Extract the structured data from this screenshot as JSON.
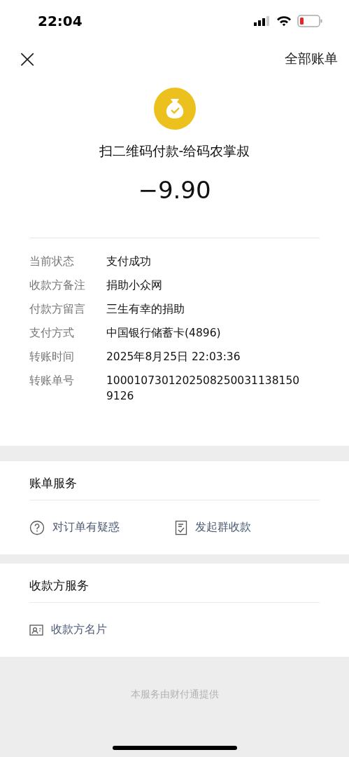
{
  "status_bar": {
    "time": "22:04"
  },
  "nav": {
    "close": "×",
    "right_link": "全部账单"
  },
  "payment": {
    "title": "扫二维码付款-给码农掌叔",
    "amount": "−9.90"
  },
  "details": [
    {
      "label": "当前状态",
      "value": "支付成功"
    },
    {
      "label": "收款方备注",
      "value": "捐助小众网"
    },
    {
      "label": "付款方留言",
      "value": "三生有幸的捐助"
    },
    {
      "label": "支付方式",
      "value": "中国银行储蓄卡(4896)"
    },
    {
      "label": "转账时间",
      "value": "2025年8月25日 22:03:36"
    },
    {
      "label": "转账单号",
      "value": "1000107301202508250031138150\n9126"
    }
  ],
  "sections": [
    {
      "title": "账单服务",
      "actions": [
        {
          "kind": "question",
          "label": "对订单有疑惑"
        },
        {
          "kind": "receipt",
          "label": "发起群收款"
        }
      ]
    },
    {
      "title": "收款方服务",
      "actions": [
        {
          "kind": "card",
          "label": "收款方名片"
        }
      ]
    }
  ],
  "footer": "本服务由财付通提供"
}
